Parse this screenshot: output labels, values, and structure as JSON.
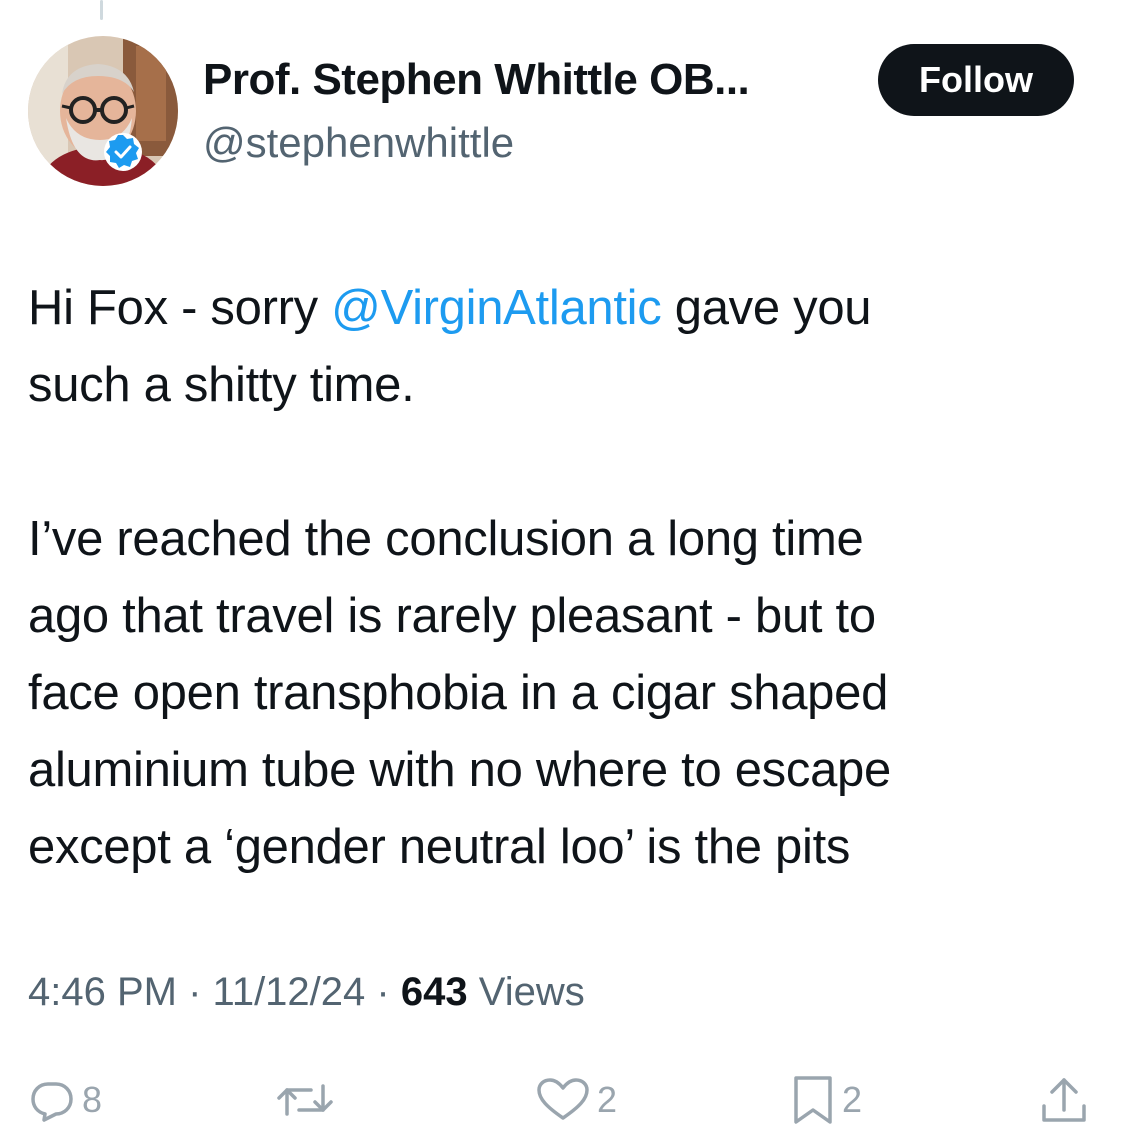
{
  "author": {
    "display_name": "Prof. Stephen Whittle OB...",
    "handle": "@stephenwhittle",
    "verified_icon": "verified-badge-icon",
    "badge_color": "#1d9bf0"
  },
  "follow_label": "Follow",
  "tweet": {
    "line1": {
      "pre": "Hi Fox - sorry ",
      "mention": "@VirginAtlantic",
      "post": " gave you"
    },
    "line2": "such a shitty time.",
    "para2": [
      "I’ve reached the conclusion a long time",
      "ago that travel is rarely pleasant - but to",
      "face open transphobia in a cigar shaped",
      "aluminium tube with no where to escape",
      "except a ‘gender neutral loo’ is the pits"
    ]
  },
  "meta": {
    "time": "4:46 PM",
    "separator": "·",
    "date": "11/12/24",
    "views_count": "643",
    "views_label": "Views"
  },
  "actions": {
    "replies": "8",
    "reposts": "",
    "likes": "2",
    "bookmarks": "2"
  },
  "colors": {
    "accent": "#1d9bf0",
    "text": "#0f1419",
    "secondary": "#536471"
  }
}
